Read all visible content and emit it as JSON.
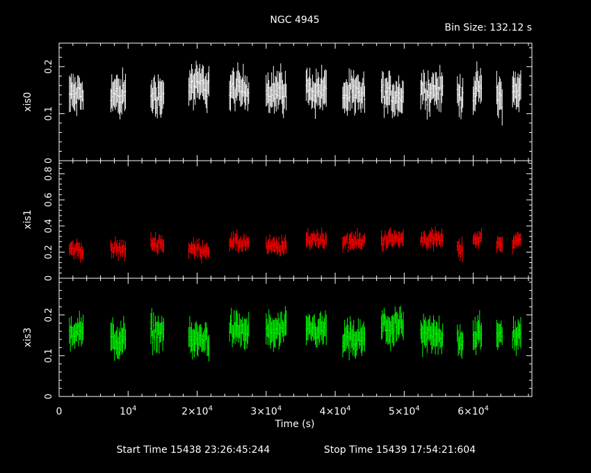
{
  "title": "NGC 4945",
  "bin_size_label": "Bin Size: 132.12 s",
  "start_time_label": "Start Time 15438 23:26:45:244",
  "stop_time_label": "Stop Time 15439 17:54:21:604",
  "colors": {
    "background": "#000000",
    "axes": "#ffffff",
    "xis0": "#ffffff",
    "xis1": "#ff0000",
    "xis3": "#00ff00"
  },
  "chart_data": {
    "type": "scatter",
    "title": "NGC 4945",
    "xlabel": "Time (s)",
    "xlim": [
      0,
      68500
    ],
    "x_ticks": [
      {
        "value": 0,
        "label": "0"
      },
      {
        "value": 10000,
        "label": "10^4"
      },
      {
        "value": 20000,
        "label": "2×10^4"
      },
      {
        "value": 30000,
        "label": "3×10^4"
      },
      {
        "value": 40000,
        "label": "4×10^4"
      },
      {
        "value": 50000,
        "label": "5×10^4"
      },
      {
        "value": 60000,
        "label": "6×10^4"
      }
    ],
    "bin_size_s": 132.12,
    "segments": [
      [
        1500,
        3500
      ],
      [
        7500,
        9700
      ],
      [
        13300,
        15200
      ],
      [
        18800,
        21800
      ],
      [
        24700,
        27500
      ],
      [
        30000,
        33000
      ],
      [
        35800,
        38800
      ],
      [
        41100,
        44300
      ],
      [
        46700,
        49900
      ],
      [
        52400,
        55700
      ],
      [
        57700,
        58600
      ],
      [
        60000,
        61300
      ],
      [
        63400,
        64300
      ],
      [
        65700,
        67000
      ]
    ],
    "panels": [
      {
        "name": "xis0",
        "ylabel": "xis0",
        "ylim": [
          0,
          0.25
        ],
        "y_ticks": [
          0,
          0.1,
          0.2
        ],
        "color": "#ffffff",
        "levels": [
          0.14,
          0.14,
          0.14,
          0.16,
          0.15,
          0.15,
          0.15,
          0.14,
          0.14,
          0.15,
          0.14,
          0.15,
          0.14,
          0.15
        ],
        "scatter": 0.035,
        "errors": 0.03
      },
      {
        "name": "xis1",
        "ylabel": "xis1",
        "ylim": [
          0,
          0.9
        ],
        "y_ticks": [
          0,
          0.2,
          0.4,
          0.6,
          0.8
        ],
        "color": "#ff0000",
        "levels": [
          0.22,
          0.22,
          0.27,
          0.22,
          0.27,
          0.24,
          0.3,
          0.28,
          0.3,
          0.3,
          0.22,
          0.3,
          0.27,
          0.28
        ],
        "scatter": 0.06,
        "errors": 0.05
      },
      {
        "name": "xis3",
        "ylabel": "xis3",
        "ylim": [
          0,
          0.29
        ],
        "y_ticks": [
          0,
          0.1,
          0.2
        ],
        "color": "#00ff00",
        "levels": [
          0.16,
          0.14,
          0.16,
          0.14,
          0.16,
          0.16,
          0.16,
          0.14,
          0.17,
          0.15,
          0.14,
          0.15,
          0.15,
          0.15
        ],
        "scatter": 0.035,
        "errors": 0.03
      }
    ]
  }
}
